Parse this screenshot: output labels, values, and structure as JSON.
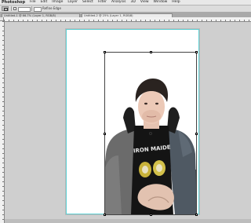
{
  "menubar": {
    "app_label": "Photoshop",
    "items": [
      "File",
      "Edit",
      "Image",
      "Layer",
      "Select",
      "Filter",
      "Analysis",
      "3D",
      "View",
      "Window",
      "Help"
    ]
  },
  "options_bar": {
    "tool_icon": "move-tool-icon",
    "refine_label": "Refine Edge"
  },
  "tabs": [
    {
      "label": "Untitled-1 @ 66.7% (Layer 1, RGB/8)"
    },
    {
      "label": "Untitled-2 @ 25% (Layer 1, RGB/8)"
    }
  ],
  "colors": {
    "canvas": "#ffffff",
    "workspace": "#cfcfcf",
    "guides": "#5fd0d4"
  },
  "image": {
    "subject": "photo of a young man in a denim jacket over a black band t-shirt"
  }
}
